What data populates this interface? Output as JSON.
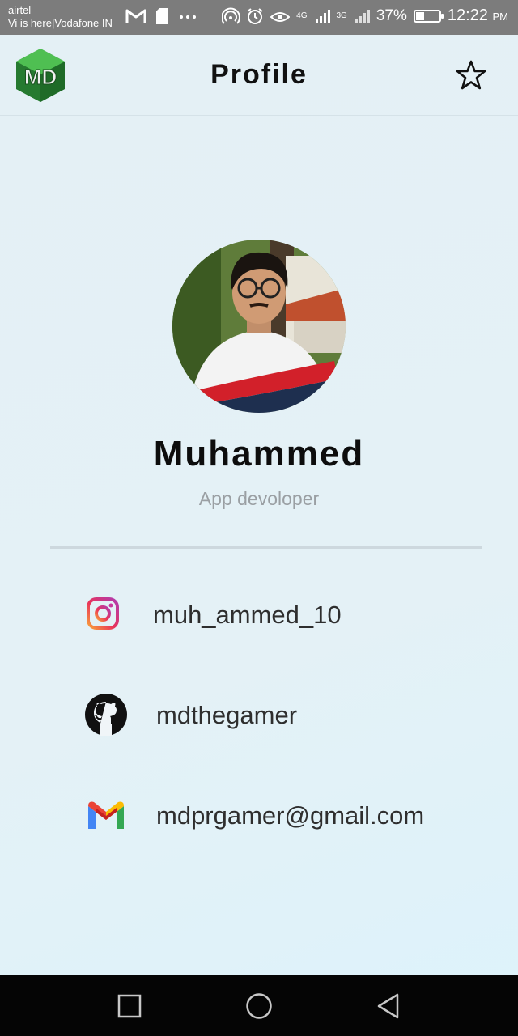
{
  "status_bar": {
    "carrier_line1": "airtel",
    "carrier_line2": "Vi is here|Vodafone IN",
    "network_1": "4G",
    "network_2": "3G",
    "battery_percent": "37%",
    "battery_level": 0.37,
    "time": "12:22",
    "time_suffix": "PM",
    "icons": [
      "gmail-icon",
      "sd-card-icon",
      "more-icon",
      "hotspot-icon",
      "alarm-icon",
      "eye-comfort-icon",
      "signal-icon",
      "signal-icon",
      "battery-icon"
    ]
  },
  "app_bar": {
    "logo_text": "MD",
    "title": "Profile",
    "action_icon": "star-outline-icon"
  },
  "profile": {
    "name": "Muhammed",
    "role": "App devoloper"
  },
  "contacts": [
    {
      "icon": "instagram-icon",
      "text": "muh_ammed_10"
    },
    {
      "icon": "github-icon",
      "text": "mdthegamer"
    },
    {
      "icon": "gmail-icon",
      "text": "mdprgamer@gmail.com"
    }
  ],
  "nav_bar": {
    "buttons": [
      "recent-apps-icon",
      "home-icon",
      "back-icon"
    ]
  },
  "colors": {
    "status_bar": "#7c7c7c",
    "background": "#e4f0f5",
    "title_text": "#111111",
    "role_text": "#9a9fa3",
    "divider": "#cdd8de",
    "nav_bar": "#050505",
    "logo_green": "#2e8b3a"
  }
}
